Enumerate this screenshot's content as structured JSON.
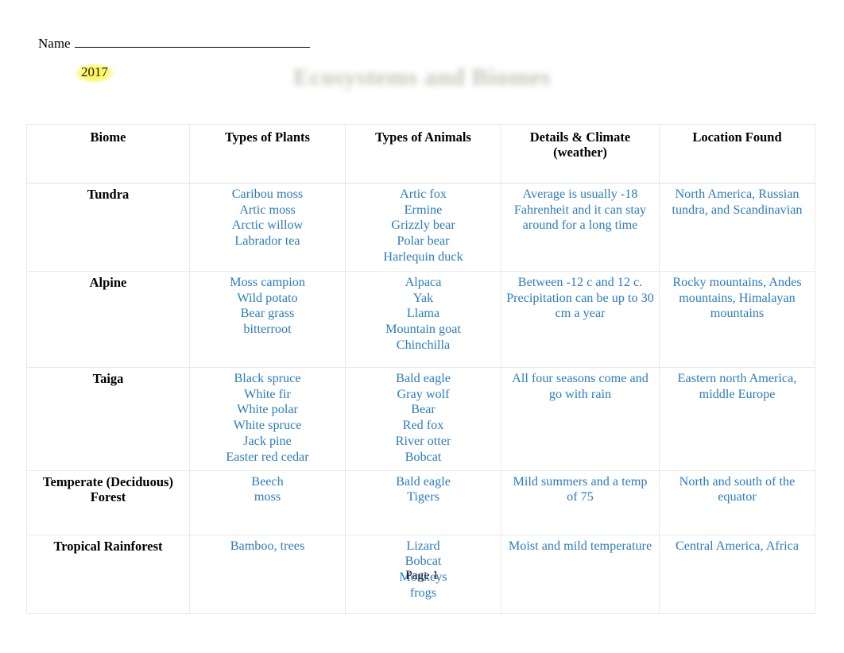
{
  "header": {
    "name_label": "Name",
    "name_value": ""
  },
  "title": {
    "year_badge": "2017",
    "text": "Ecosystems and Biomes"
  },
  "table": {
    "columns": [
      "Biome",
      "Types of Plants",
      "Types of Animals",
      "Details & Climate (weather)",
      "Location Found"
    ],
    "columns_display": {
      "biome": "Biome",
      "plants": "Types of Plants",
      "animals": "Types of Animals",
      "details_line1": "Details & Climate",
      "details_line2": "(weather)",
      "location": "Location Found"
    },
    "rows": [
      {
        "biome": "Tundra",
        "plants": [
          "Caribou moss",
          "Artic moss",
          "Arctic willow",
          "Labrador tea"
        ],
        "animals": [
          "Artic fox",
          "Ermine",
          "Grizzly bear",
          "Polar bear",
          "Harlequin duck"
        ],
        "details": "Average is usually -18 Fahrenheit and it can stay around for a long time",
        "location": "North America, Russian tundra, and Scandinavian"
      },
      {
        "biome": "Alpine",
        "plants": [
          "Moss campion",
          "Wild potato",
          "Bear grass",
          "bitterroot"
        ],
        "animals": [
          "Alpaca",
          "Yak",
          "Llama",
          "Mountain goat",
          "Chinchilla"
        ],
        "details": "Between -12 c and 12 c. Precipitation can be up to 30 cm a year",
        "location": "Rocky mountains, Andes mountains, Himalayan mountains"
      },
      {
        "biome": "Taiga",
        "plants": [
          "Black spruce",
          "White fir",
          "White polar",
          "White spruce",
          "Jack pine",
          "Easter red cedar"
        ],
        "animals": [
          "Bald eagle",
          "Gray wolf",
          "Bear",
          "Red fox",
          "River otter",
          "Bobcat"
        ],
        "details": "All four seasons come and go with rain",
        "location": "Eastern north America, middle Europe"
      },
      {
        "biome": "Temperate (Deciduous) Forest",
        "plants": [
          "Beech",
          "moss"
        ],
        "animals": [
          "Bald eagle",
          "Tigers"
        ],
        "details": "Mild summers and a temp of 75",
        "location": "North and south of the equator"
      },
      {
        "biome": "Tropical Rainforest",
        "plants": [
          "Bamboo, trees"
        ],
        "animals": [
          "Lizard",
          "Bobcat",
          "Monkeys",
          "frogs"
        ],
        "details": "Moist and mild temperature",
        "location": "Central America, Africa"
      }
    ]
  },
  "footer": {
    "page_label": "Page 1"
  },
  "colors": {
    "data_text": "#2b7cc1",
    "header_text": "#000000",
    "title_faded": "#b9b9a8",
    "highlight": "#fff850",
    "border": "#e9e9e9"
  }
}
